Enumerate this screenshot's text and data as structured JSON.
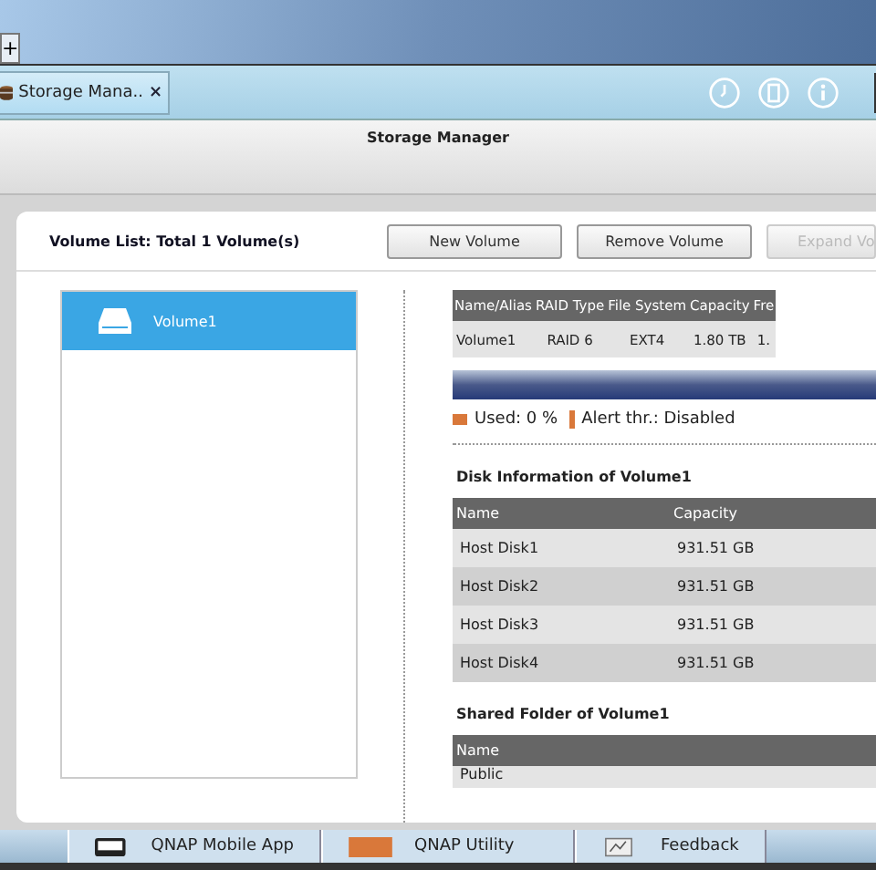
{
  "top_bar": {
    "add_tab": "+"
  },
  "tab_bar": {
    "tabs": [
      {
        "label": "Storage Mana..",
        "close": "×",
        "selected": true
      }
    ]
  },
  "window": {
    "title": "Storage Manager"
  },
  "volume_list": {
    "title": "Volume List: Total 1 Volume(s)",
    "buttons": [
      {
        "label": "New Volume",
        "disabled": false
      },
      {
        "label": "Remove Volume",
        "disabled": false
      },
      {
        "label": "Expand Vo",
        "disabled": true
      }
    ],
    "items": [
      {
        "label": "Volume1",
        "selected": true
      }
    ]
  },
  "volume_table": {
    "columns": [
      "Name/Alias",
      "RAID Type",
      "File System",
      "Capacity",
      "Fre"
    ],
    "rows": [
      [
        "Volume1",
        "RAID 6",
        "EXT4",
        "1.80 TB",
        "1."
      ]
    ]
  },
  "usage": {
    "level": 0,
    "used": "Used: 0 %",
    "alert": "Alert thr.: Disabled"
  },
  "disk_info": {
    "title": "Disk Information of Volume1",
    "columns": [
      "Name",
      "Capacity"
    ],
    "rows": [
      [
        "Host Disk1",
        "931.51 GB"
      ],
      [
        "Host Disk2",
        "931.51 GB"
      ],
      [
        "Host Disk3",
        "931.51 GB"
      ],
      [
        "Host Disk4",
        "931.51 GB"
      ]
    ]
  },
  "shared_folders": {
    "title": "Shared Folder of Volume1",
    "columns": [
      "Name"
    ],
    "rows": [
      [
        "Public"
      ]
    ]
  },
  "taskbar": [
    {
      "label": "QNAP Mobile App",
      "kind": "phone"
    },
    {
      "label": "QNAP Utility",
      "kind": "box"
    },
    {
      "label": "Feedback",
      "kind": "chart"
    }
  ]
}
